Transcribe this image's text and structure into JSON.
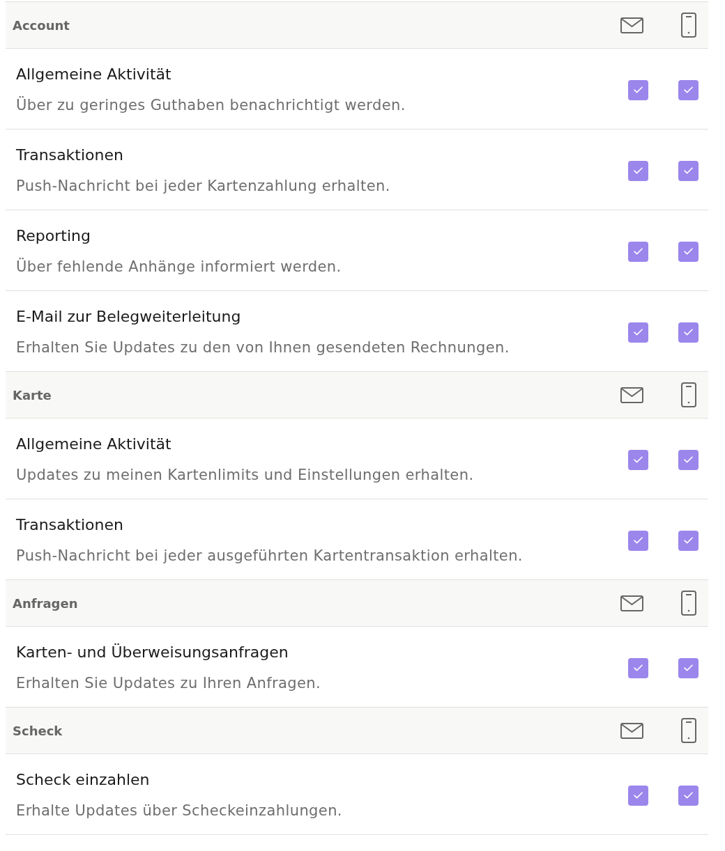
{
  "sections": [
    {
      "title": "Account",
      "items": [
        {
          "title": "Allgemeine Aktivität",
          "description": "Über zu geringes Guthaben benachrichtigt werden.",
          "email_checked": true,
          "push_checked": true
        },
        {
          "title": "Transaktionen",
          "description": "Push-Nachricht bei jeder Kartenzahlung erhalten.",
          "email_checked": true,
          "push_checked": true
        },
        {
          "title": "Reporting",
          "description": "Über fehlende Anhänge informiert werden.",
          "email_checked": true,
          "push_checked": true
        },
        {
          "title": "E-Mail zur Belegweiterleitung",
          "description": "Erhalten Sie Updates zu den von Ihnen gesendeten Rechnungen.",
          "email_checked": true,
          "push_checked": true
        }
      ]
    },
    {
      "title": "Karte",
      "items": [
        {
          "title": "Allgemeine Aktivität",
          "description": "Updates zu meinen Kartenlimits und Einstellungen erhalten.",
          "email_checked": true,
          "push_checked": true
        },
        {
          "title": "Transaktionen",
          "description": "Push-Nachricht bei jeder ausgeführten Kartentransaktion erhalten.",
          "email_checked": true,
          "push_checked": true
        }
      ]
    },
    {
      "title": "Anfragen",
      "items": [
        {
          "title": "Karten- und Überweisungsanfragen",
          "description": "Erhalten Sie Updates zu Ihren Anfragen.",
          "email_checked": true,
          "push_checked": true
        }
      ]
    },
    {
      "title": "Scheck",
      "items": [
        {
          "title": "Scheck einzahlen",
          "description": "Erhalte Updates über Scheckeinzahlungen.",
          "email_checked": true,
          "push_checked": true
        }
      ]
    }
  ]
}
